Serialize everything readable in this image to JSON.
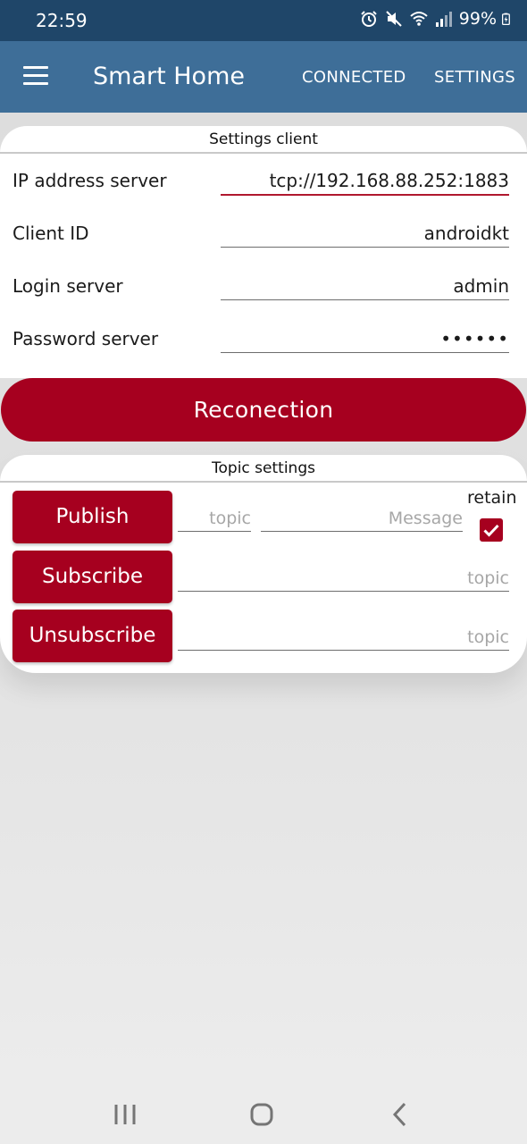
{
  "status_bar": {
    "time": "22:59",
    "battery": "99%",
    "icons": [
      "alarm-icon",
      "mute-icon",
      "wifi-icon",
      "signal-icon",
      "battery-charging-icon"
    ]
  },
  "app_bar": {
    "title": "Smart Home",
    "actions": [
      "CONNECTED",
      "SETTINGS"
    ]
  },
  "settings_client": {
    "title": "Settings client",
    "fields": [
      {
        "label": "IP address server",
        "value": "tcp://192.168.88.252:1883"
      },
      {
        "label": "Client ID",
        "value": "androidkt"
      },
      {
        "label": "Login server",
        "value": "admin"
      },
      {
        "label": "Password server",
        "value": "••••••"
      }
    ]
  },
  "reconnect_label": "Reconection",
  "topic_settings": {
    "title": "Topic settings",
    "publish": {
      "button": "Publish",
      "topic_placeholder": "topic",
      "message_placeholder": "Message",
      "retain_label": "retain",
      "retain_checked": true
    },
    "subscribe": {
      "button": "Subscribe",
      "topic_placeholder": "topic"
    },
    "unsubscribe": {
      "button": "Unsubscribe",
      "topic_placeholder": "topic"
    }
  },
  "colors": {
    "status_bar": "#1f4669",
    "app_bar": "#3e6e98",
    "accent": "#a6001f",
    "active_underline": "#b0182f"
  },
  "nav_bar": {
    "icons": [
      "recents-icon",
      "home-icon",
      "back-icon"
    ]
  }
}
